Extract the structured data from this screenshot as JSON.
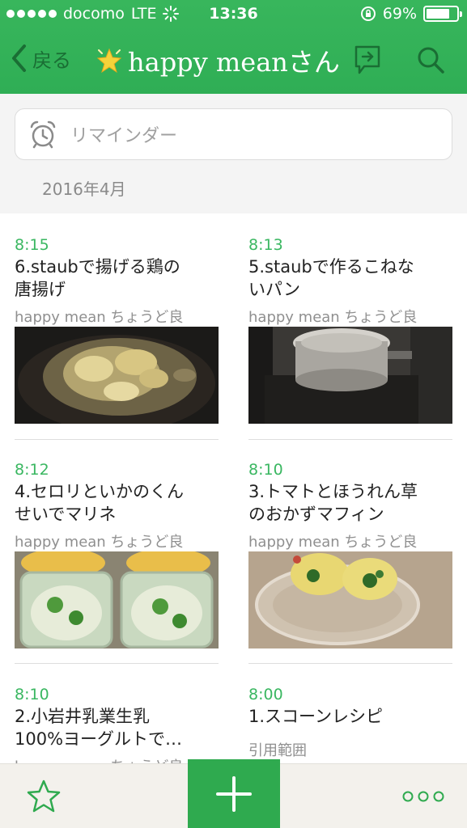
{
  "status_bar": {
    "carrier": "docomo",
    "network": "LTE",
    "time": "13:36",
    "battery": "69%",
    "battery_level": 0.69
  },
  "nav": {
    "back_label": "戻る",
    "title": "happy meanさん"
  },
  "reminder": {
    "label": "リマインダー"
  },
  "month_header": "2016年4月",
  "notes": [
    {
      "time": "8:15",
      "title_lines": [
        "6.staubで揚げる鶏の",
        "唐揚げ"
      ],
      "author": "happy mean ちょうど良"
    },
    {
      "time": "8:13",
      "title_lines": [
        "5.staubで作るこねな",
        "いパン"
      ],
      "author": "happy mean ちょうど良"
    },
    {
      "time": "8:12",
      "title_lines": [
        "4.セロリといかのくん",
        "せいでマリネ"
      ],
      "author": "happy mean ちょうど良"
    },
    {
      "time": "8:10",
      "title_lines": [
        "3.トマトとほうれん草",
        "のおかずマフィン"
      ],
      "author": "happy mean ちょうど良"
    },
    {
      "time": "8:10",
      "title_lines": [
        "2.小岩井乳業生乳",
        "100%ヨーグルトで…"
      ],
      "author": "happy mean ちょうど良"
    },
    {
      "time": "8:00",
      "title_lines": [
        "1.スコーンレシピ"
      ],
      "snippet": "引用範囲"
    }
  ],
  "colors": {
    "accent": "#2faa4f",
    "header": "#38b65c",
    "time_text": "#3ab761"
  },
  "icons": {
    "back": "chevron-left-icon",
    "title": "sparkle-star-icon",
    "share": "share-icon",
    "search": "search-icon",
    "reminder": "alarm-clock-icon",
    "favorite": "star-outline-icon",
    "add": "plus-icon",
    "more": "more-dots-icon"
  }
}
